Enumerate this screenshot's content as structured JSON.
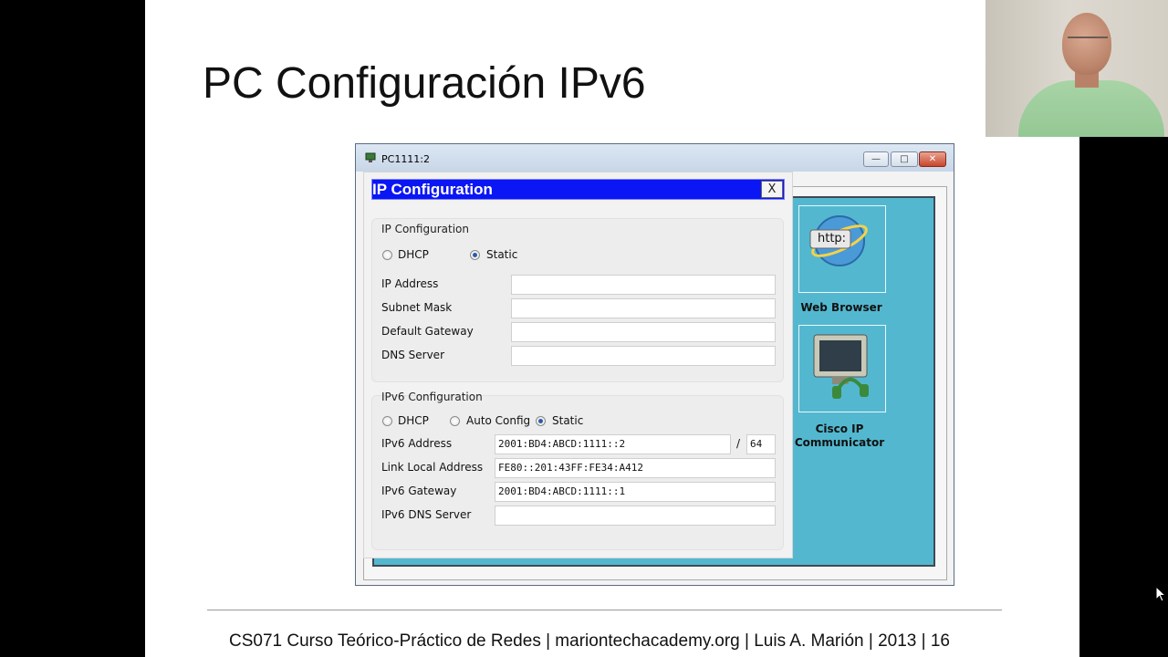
{
  "slide": {
    "title": "PC Configuración IPv6",
    "footer": "CS071 Curso Teórico-Práctico de Redes | mariontechacademy.org |  Luis A. Marión | 2013 |  16"
  },
  "window": {
    "title": "PC1111:2",
    "minimize_icon": "minimize-icon",
    "maximize_icon": "maximize-icon",
    "close_icon": "close-icon"
  },
  "ip_config": {
    "header": "IP Configuration",
    "close_label": "X",
    "ipv4": {
      "title": "IP Configuration",
      "dhcp_label": "DHCP",
      "static_label": "Static",
      "selected": "Static",
      "ip_address_label": "IP Address",
      "ip_address": "",
      "subnet_mask_label": "Subnet Mask",
      "subnet_mask": "",
      "default_gateway_label": "Default Gateway",
      "default_gateway": "",
      "dns_server_label": "DNS Server",
      "dns_server": ""
    },
    "ipv6": {
      "title": "IPv6 Configuration",
      "dhcp_label": "DHCP",
      "auto_label": "Auto Config",
      "static_label": "Static",
      "selected": "Static",
      "address_label": "IPv6 Address",
      "address": "2001:BD4:ABCD:1111::2",
      "prefix_separator": "/",
      "prefix": "64",
      "link_local_label": "Link Local Address",
      "link_local": "FE80::201:43FF:FE34:A412",
      "gateway_label": "IPv6 Gateway",
      "gateway": "2001:BD4:ABCD:1111::1",
      "dns_label": "IPv6 DNS Server",
      "dns": ""
    }
  },
  "desktop_apps": [
    {
      "label": "Web Browser",
      "icon": "web-browser-icon",
      "badge": "http:"
    },
    {
      "label_line1": "Cisco IP",
      "label_line2": "Communicator",
      "icon": "cisco-ip-communicator-icon"
    }
  ],
  "colors": {
    "header_blue": "#0a16f4",
    "desktop_teal": "#53b8cf"
  }
}
